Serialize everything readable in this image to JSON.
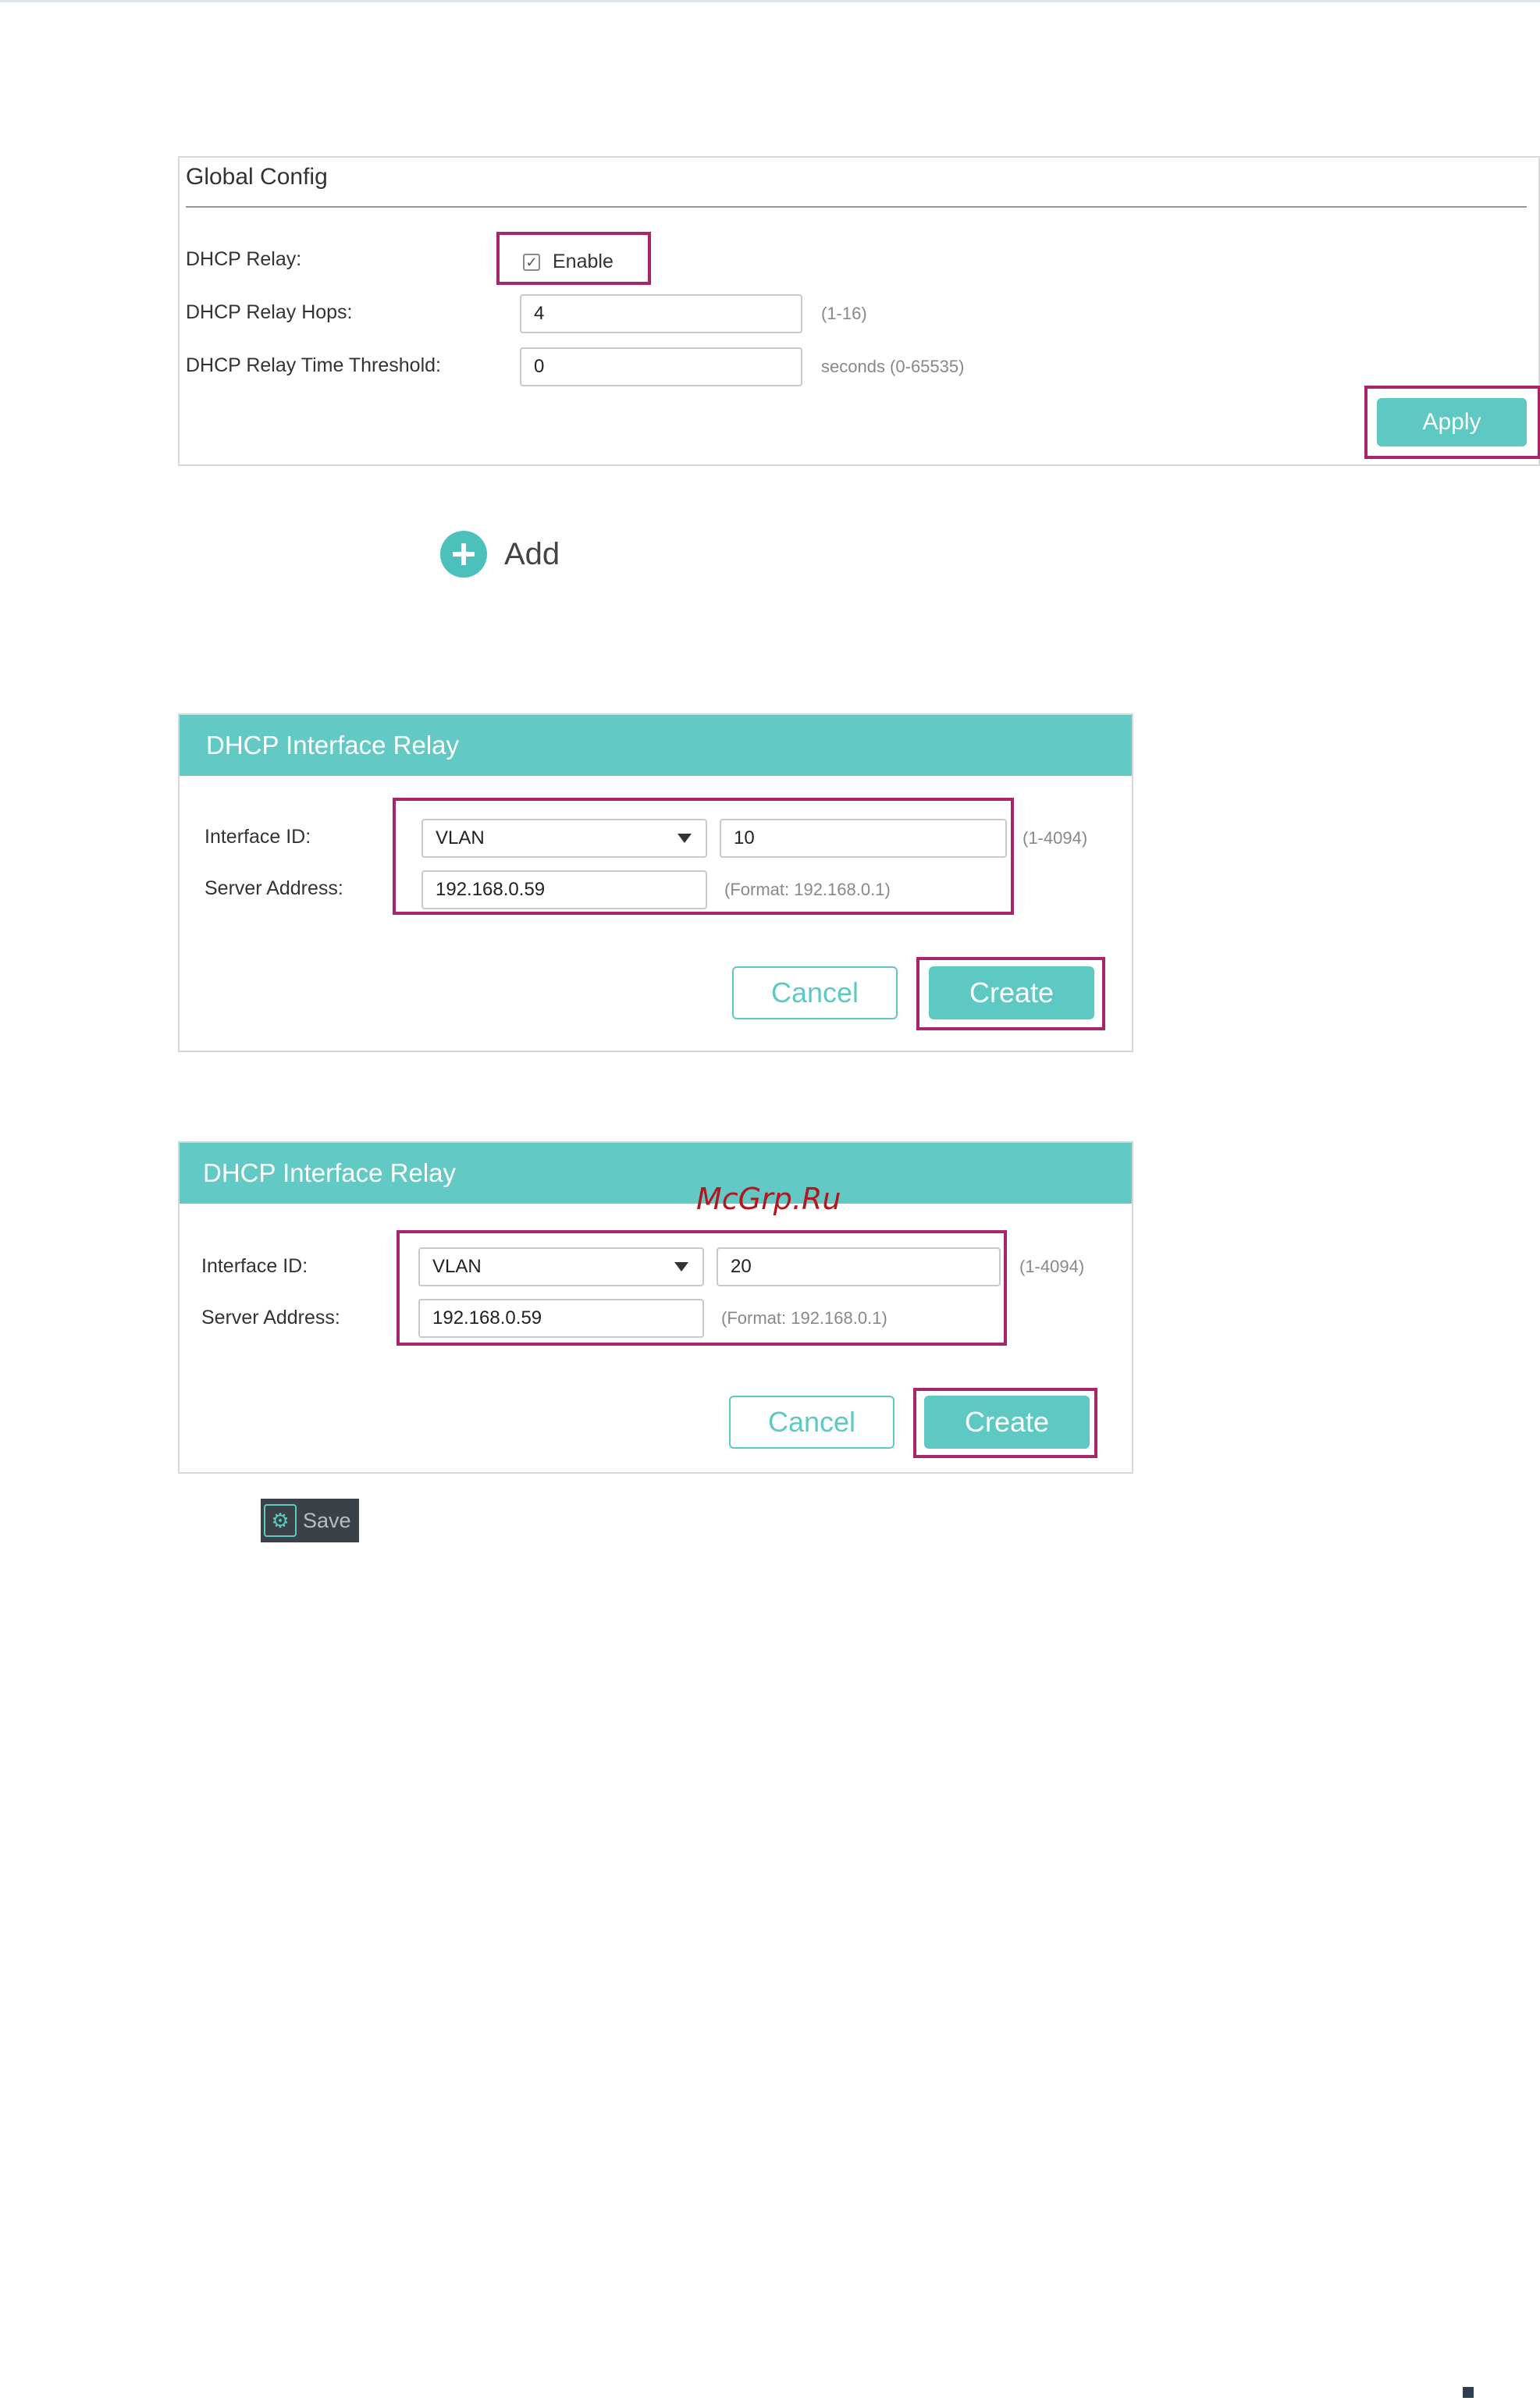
{
  "global_config": {
    "title": "Global Config",
    "dhcp_relay_label": "DHCP Relay:",
    "enable_label": "Enable",
    "enable_checked": true,
    "hops_label": "DHCP Relay Hops:",
    "hops_value": "4",
    "hops_hint": "(1-16)",
    "threshold_label": "DHCP Relay Time Threshold:",
    "threshold_value": "0",
    "threshold_hint": "seconds (0-65535)",
    "apply_label": "Apply"
  },
  "add": {
    "label": "Add",
    "icon": "plus-circle-icon"
  },
  "relay_panels": [
    {
      "title": "DHCP Interface Relay",
      "interface_label": "Interface ID:",
      "interface_type": "VLAN",
      "interface_value": "10",
      "interface_hint": "(1-4094)",
      "server_label": "Server Address:",
      "server_value": "192.168.0.59",
      "server_hint": "(Format: 192.168.0.1)",
      "cancel_label": "Cancel",
      "create_label": "Create"
    },
    {
      "title": "DHCP Interface Relay",
      "interface_label": "Interface ID:",
      "interface_type": "VLAN",
      "interface_value": "20",
      "interface_hint": "(1-4094)",
      "server_label": "Server Address:",
      "server_value": "192.168.0.59",
      "server_hint": "(Format: 192.168.0.1)",
      "cancel_label": "Cancel",
      "create_label": "Create"
    }
  ],
  "watermark": "McGrp.Ru",
  "save": {
    "label": "Save",
    "icon": "save-gear-icon"
  },
  "colors": {
    "accent": "#5ec8c3",
    "highlight": "#a8256b",
    "header": "#63c9c4"
  }
}
